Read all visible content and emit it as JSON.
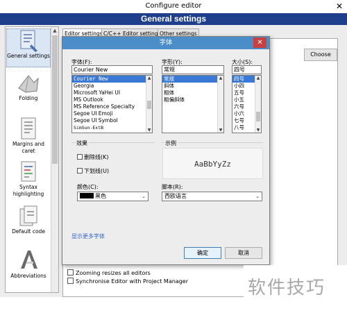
{
  "window": {
    "title": "Configure editor",
    "close_glyph": "✕",
    "header": "General settings"
  },
  "sidebar": {
    "items": [
      {
        "label": "General settings",
        "icon": "general-settings-icon",
        "selected": true
      },
      {
        "label": "Folding",
        "icon": "folding-icon"
      },
      {
        "label": "Margins and caret",
        "icon": "margins-caret-icon"
      },
      {
        "label": "Syntax highlighting",
        "icon": "syntax-highlighting-icon"
      },
      {
        "label": "Default code",
        "icon": "default-code-icon"
      },
      {
        "label": "Abbreviations",
        "icon": "abbreviations-icon"
      }
    ]
  },
  "tabs": [
    {
      "label": "Editor settings",
      "active": true
    },
    {
      "label": "C/C++ Editor settings"
    },
    {
      "label": "Other settings"
    }
  ],
  "main": {
    "choose_label": "Choose",
    "zoom_checkbox": "Zooming resizes all editors",
    "sync_checkbox": "Synchronise Editor with Project Manager"
  },
  "font_dialog": {
    "title": "字体",
    "close_glyph": "✕",
    "font_label": "字体(F):",
    "font_value": "Courier New",
    "font_list": [
      "Courier New",
      "Georgia",
      "Microsoft YaHei UI",
      "MS Outlook",
      "MS Reference Specialty",
      "Segoe UI Emoji",
      "Segoe UI Symbol",
      "SimSun-ExtB"
    ],
    "style_label": "字形(Y):",
    "style_value": "常规",
    "style_list": [
      "常规",
      "斜体",
      "粗体",
      "粗偏斜体"
    ],
    "size_label": "大小(S):",
    "size_value": "四号",
    "size_list": [
      "四号",
      "小四",
      "五号",
      "小五",
      "六号",
      "小六",
      "七号",
      "八号"
    ],
    "effects_label": "效果",
    "strikeout_label": "删除线(K)",
    "underline_label": "下划线(U)",
    "color_label": "颜色(C):",
    "color_value": "黑色",
    "sample_label": "示例",
    "sample_text": "AaBbYyZz",
    "script_label": "脚本(R):",
    "script_value": "西欧语言",
    "more_fonts_link": "显示更多字体",
    "ok_label": "确定",
    "cancel_label": "取消"
  },
  "watermark": "软件技巧",
  "colors": {
    "header_bg": "#1f3f8c",
    "dialog_title_bg": "#4a8dc9",
    "dialog_close_bg": "#c94040",
    "selection": "#3a78d6",
    "link": "#3263c9"
  }
}
